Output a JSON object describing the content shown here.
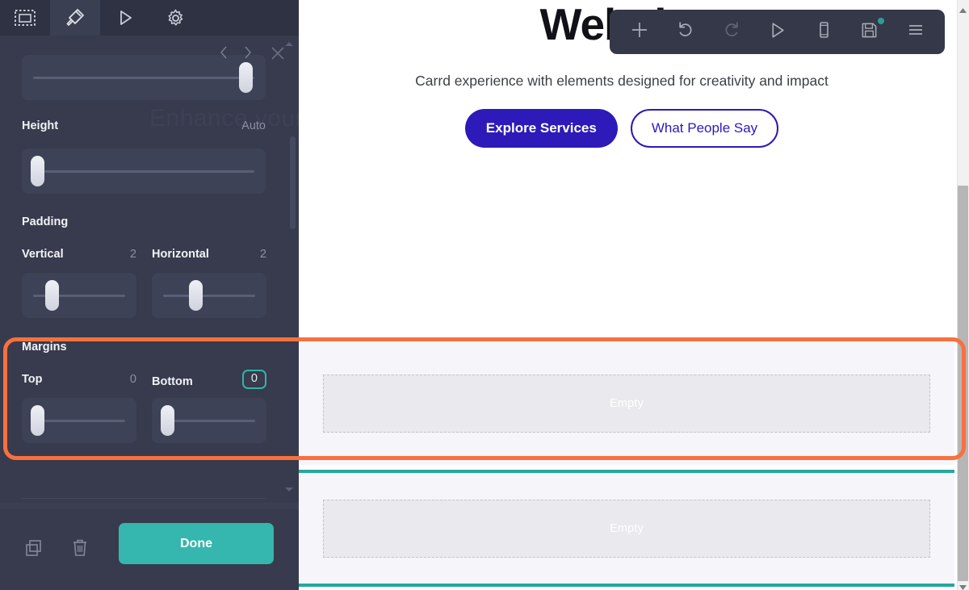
{
  "editor_panel": {
    "tabs": [
      {
        "name": "select-tool",
        "icon": "dashed-rectangle-icon",
        "active": false
      },
      {
        "name": "style-tool",
        "icon": "paint-brush-icon",
        "active": true
      },
      {
        "name": "preview-tool",
        "icon": "play-triangle-icon",
        "active": false
      },
      {
        "name": "settings-tool",
        "icon": "gear-icon",
        "active": false
      }
    ],
    "nav": {
      "prev_icon": "chevron-left-icon",
      "next_icon": "chevron-right-icon",
      "close_icon": "close-x-icon"
    },
    "ghost_text": "Enhance your",
    "fields": [
      {
        "label": "Height",
        "value": "Auto"
      }
    ],
    "sections": [
      {
        "title": "Padding",
        "controls": [
          {
            "label": "Vertical",
            "value": "2",
            "highlighted": false
          },
          {
            "label": "Horizontal",
            "value": "2",
            "highlighted": false
          }
        ]
      },
      {
        "title": "Margins",
        "controls": [
          {
            "label": "Top",
            "value": "0",
            "highlighted": false
          },
          {
            "label": "Bottom",
            "value": "0",
            "highlighted": true
          }
        ]
      }
    ],
    "footer": {
      "duplicate_icon": "duplicate-icon",
      "delete_icon": "trash-icon",
      "done_label": "Done"
    },
    "colors": {
      "panel_bg": "#373b4d",
      "tabbar_bg": "#2f3242",
      "done_button": "#35b6ae",
      "highlight_outline": "#31b3a8"
    }
  },
  "canvas": {
    "toolbar": [
      {
        "name": "add-button",
        "icon": "plus-icon",
        "dimmed": false
      },
      {
        "name": "undo-button",
        "icon": "undo-arrow-icon",
        "dimmed": false
      },
      {
        "name": "redo-button",
        "icon": "redo-arrow-icon",
        "dimmed": true
      },
      {
        "name": "preview-button",
        "icon": "play-triangle-icon",
        "dimmed": false
      },
      {
        "name": "mobile-view-button",
        "icon": "mobile-phone-icon",
        "dimmed": false
      },
      {
        "name": "save-button",
        "icon": "floppy-disk-icon",
        "dimmed": false,
        "badge": true
      },
      {
        "name": "menu-button",
        "icon": "hamburger-menu-icon",
        "dimmed": false
      }
    ],
    "hero": {
      "title": "Website",
      "subtitle": "Carrd experience with elements designed for creativity and impact",
      "primary_button": "Explore Services",
      "secondary_button": "What People Say"
    },
    "sections": [
      {
        "label": "Empty"
      },
      {
        "label": "Empty"
      }
    ],
    "colors": {
      "primary_button": "#2d1ab9",
      "section_bg": "#f6f6fa",
      "placeholder_bg": "#e9e9ee",
      "divider_teal": "#23a8a0"
    }
  },
  "annotation": {
    "highlight_color": "#f9703e",
    "target": "margins-section"
  }
}
